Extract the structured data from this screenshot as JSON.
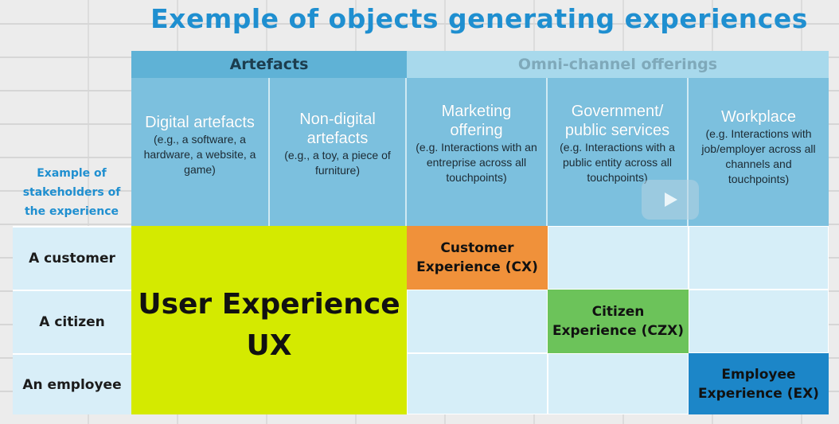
{
  "title": "Exemple of objects generating experiences",
  "header_groups": {
    "artefacts": "Artefacts",
    "omni": "Omni-channel offerings"
  },
  "stakeholder_label": [
    "Example of",
    "stakeholders of",
    "the experience"
  ],
  "columns": [
    {
      "title": [
        "Digital artefacts"
      ],
      "desc": [
        "(e.g., a software, a",
        "hardware, a website, a",
        "game)"
      ]
    },
    {
      "title": [
        "Non-digital",
        "artefacts"
      ],
      "desc": [
        "(e.g., a toy, a piece of",
        "furniture)"
      ]
    },
    {
      "title": [
        "Marketing",
        "offering"
      ],
      "desc": [
        "(e.g. Interactions with an",
        "entreprise across all",
        "touchpoints)"
      ]
    },
    {
      "title": [
        "Government/",
        "public services"
      ],
      "desc": [
        "(e.g. Interactions with a",
        "public entity across all",
        "touchpoints)"
      ]
    },
    {
      "title": [
        "Workplace"
      ],
      "desc": [
        "(e.g. Interactions with",
        "job/employer across all",
        "channels and",
        "touchpoints)"
      ]
    }
  ],
  "rows": [
    "A customer",
    "A citizen",
    "An employee"
  ],
  "ux": [
    "User Experience",
    "UX"
  ],
  "cx": [
    "Customer",
    "Experience (CX)"
  ],
  "czx": [
    "Citizen",
    "Experience (CZX)"
  ],
  "ex": [
    "Employee",
    "Experience (EX)"
  ],
  "colors": {
    "title": "#1f8fd0",
    "ux": "#d4ea00",
    "cx": "#f0913a",
    "czx": "#6cc35a",
    "ex": "#1c86c8",
    "stakeholder_label": "#1f8fd0"
  }
}
